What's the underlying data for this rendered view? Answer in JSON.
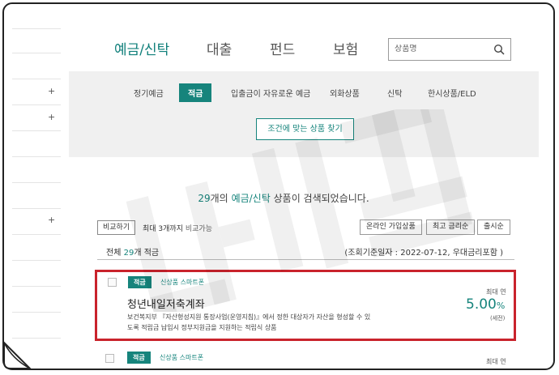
{
  "nav": {
    "tabs": [
      {
        "label": "예금/신탁",
        "active": true
      },
      {
        "label": "대출",
        "active": false
      },
      {
        "label": "펀드",
        "active": false
      },
      {
        "label": "보험",
        "active": false
      }
    ],
    "search_placeholder": "상품명"
  },
  "sidebar": {
    "plus": [
      "+",
      "+",
      "+"
    ]
  },
  "filter": {
    "subtabs": [
      {
        "label": "정기예금",
        "active": false
      },
      {
        "label": "적금",
        "active": true
      },
      {
        "label": "입출금이 자유로운 예금",
        "active": false
      },
      {
        "label": "외화상품",
        "active": false
      },
      {
        "label": "신탁",
        "active": false
      },
      {
        "label": "한시상품/ELD",
        "active": false
      }
    ],
    "condition_button": "조건에 맞는 상품 찾기"
  },
  "results": {
    "count": "29",
    "count_suffix": "개의",
    "category": "예금/신탁",
    "message": "상품이 검색되었습니다.",
    "compare_button": "비교하기",
    "compare_note": "최대 3개까지",
    "compare_note2": "비교가능",
    "sort_buttons": [
      "온라인 가입상품",
      "최고 금리순",
      "출시순"
    ],
    "total_label": "전체",
    "total_count": "29",
    "total_suffix": "개 적금",
    "basis": "(조회기준일자 : 2022-07-12, 우대금리포함 )"
  },
  "products": [
    {
      "badge": "적금",
      "tags": "신상품 스마트폰",
      "name": "청년내일저축계좌",
      "desc_line1": "보건복지부 『자산형성지원 통장사업(운영지침)』에서 정한 대상자가 자산을 형성할 수 있",
      "desc_line2": "도록 적립금 납입시 정부지원금을 지원하는 적립식 상품",
      "rate_label": "최대 연",
      "rate_value": "5.00",
      "rate_unit": "%",
      "rate_note": "(세전)"
    },
    {
      "badge": "적금",
      "tags": "신상품 스마트폰",
      "rate_label": "최대 연"
    }
  ],
  "colors": {
    "teal": "#16847c",
    "highlight": "#c9232c",
    "panel": "#f0f0f0"
  }
}
